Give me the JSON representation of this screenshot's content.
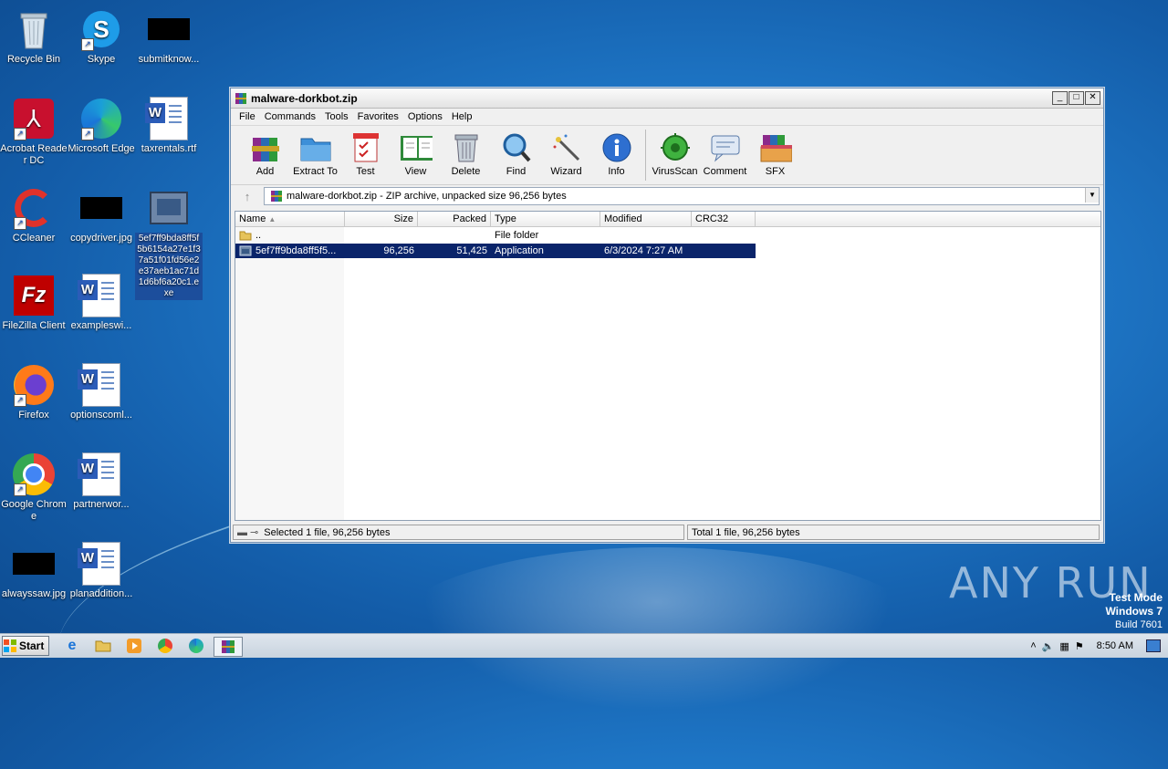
{
  "desktop": {
    "icons": [
      {
        "label": "Recycle Bin",
        "icon": "recycle-bin-icon"
      },
      {
        "label": "Skype",
        "icon": "skype-icon"
      },
      {
        "label": "submitknow...",
        "icon": "redacted-thumbnail"
      },
      {
        "label": "Acrobat Reader DC",
        "icon": "acrobat-icon"
      },
      {
        "label": "Microsoft Edge",
        "icon": "edge-icon"
      },
      {
        "label": "taxrentals.rtf",
        "icon": "word-doc-icon"
      },
      {
        "label": "CCleaner",
        "icon": "ccleaner-icon"
      },
      {
        "label": "copydriver.jpg",
        "icon": "redacted-thumbnail"
      },
      {
        "label": "5ef7ff9bda8ff5f5b6154a27e1f37a51f01fd56e2e37aeb1ac71d1d6bf6a20c1.exe",
        "icon": "exe-icon"
      },
      {
        "label": "FileZilla Client",
        "icon": "filezilla-icon"
      },
      {
        "label": "exampleswi...",
        "icon": "word-doc-icon"
      },
      {
        "label": "Firefox",
        "icon": "firefox-icon"
      },
      {
        "label": "optionscoml...",
        "icon": "word-doc-icon"
      },
      {
        "label": "Google Chrome",
        "icon": "chrome-icon"
      },
      {
        "label": "partnerwor...",
        "icon": "word-doc-icon"
      },
      {
        "label": "alwayssaw.jpg",
        "icon": "redacted-thumbnail"
      },
      {
        "label": "planaddition...",
        "icon": "word-doc-icon"
      }
    ]
  },
  "window": {
    "title": "malware-dorkbot.zip",
    "controls": {
      "minimize": "_",
      "maximize": "□",
      "close": "✕"
    },
    "menu": [
      "File",
      "Commands",
      "Tools",
      "Favorites",
      "Options",
      "Help"
    ],
    "toolbar": [
      {
        "label": "Add",
        "icon": "add-icon"
      },
      {
        "label": "Extract To",
        "icon": "extract-folder-icon"
      },
      {
        "label": "Test",
        "icon": "test-checklist-icon"
      },
      {
        "label": "View",
        "icon": "view-book-icon"
      },
      {
        "label": "Delete",
        "icon": "trash-icon"
      },
      {
        "label": "Find",
        "icon": "magnifier-icon"
      },
      {
        "label": "Wizard",
        "icon": "wand-icon"
      },
      {
        "label": "Info",
        "icon": "info-icon"
      },
      {
        "label": "VirusScan",
        "icon": "virus-icon"
      },
      {
        "label": "Comment",
        "icon": "comment-icon"
      },
      {
        "label": "SFX",
        "icon": "sfx-box-icon"
      }
    ],
    "address": "malware-dorkbot.zip - ZIP archive, unpacked size 96,256 bytes",
    "columns": [
      "Name",
      "Size",
      "Packed",
      "Type",
      "Modified",
      "CRC32"
    ],
    "rows": [
      {
        "name": "..",
        "size": "",
        "packed": "",
        "type": "File folder",
        "modified": "",
        "crc": ""
      },
      {
        "name": "5ef7ff9bda8ff5f5...",
        "size": "96,256",
        "packed": "51,425",
        "type": "Application",
        "modified": "6/3/2024 7:27 AM",
        "crc": ""
      }
    ],
    "status_left": "Selected 1 file, 96,256 bytes",
    "status_right": "Total 1 file, 96,256 bytes"
  },
  "watermark": {
    "brand": "ANY RUN",
    "line1": "Test Mode",
    "line2": "Windows 7",
    "line3": "Build 7601"
  },
  "taskbar": {
    "start": "Start",
    "clock": "8:50 AM"
  },
  "colors": {
    "selection": "#0a246a",
    "desktop": "#1f78c8"
  }
}
